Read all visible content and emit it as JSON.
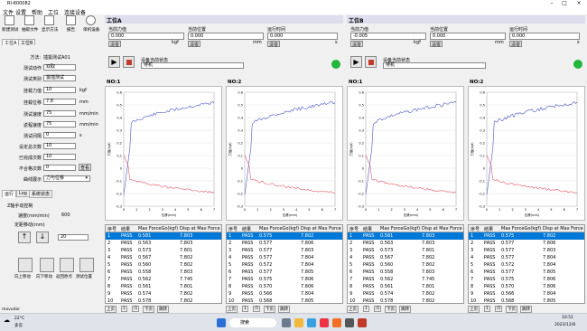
{
  "window": {
    "title": "RI-600082"
  },
  "menu": [
    "文件",
    "设置",
    "帮助",
    "工位",
    "连接设备"
  ],
  "toolbar": [
    {
      "label": "新建测试",
      "icon": "new-test-icon"
    },
    {
      "label": "抽取文件",
      "icon": "open-file-icon"
    },
    {
      "label": "显示方法",
      "icon": "method-icon"
    },
    {
      "label": "报告",
      "icon": "report-icon"
    },
    {
      "label": "单机设备",
      "icon": "gear-icon"
    }
  ],
  "left_tabs": [
    "工位A",
    "工位B"
  ],
  "method": {
    "label": "方法:",
    "value": "插拔测试A01"
  },
  "params": [
    {
      "label": "测试动作",
      "value": "双取",
      "unit": ""
    },
    {
      "label": "测试类别",
      "value": "拔插测试",
      "unit": ""
    },
    {
      "label": "挂载力值",
      "value": "10",
      "unit": "kgf"
    },
    {
      "label": "挂载位移",
      "value": "7.8",
      "unit": "mm"
    },
    {
      "label": "测试速度",
      "value": "75",
      "mm_unit": true,
      "unit": "mm/min"
    },
    {
      "label": "返程速度",
      "value": "75",
      "unit": "mm/min"
    },
    {
      "label": "测试间隔",
      "value": "0",
      "unit": "s"
    },
    {
      "label": "设定总次数",
      "value": "10",
      "unit": ""
    },
    {
      "label": "已完成次数",
      "value": "10",
      "unit": ""
    },
    {
      "label": "不合格次数",
      "value": "0",
      "unit": ""
    }
  ],
  "view_btn": "查看",
  "curve_label": "曲线展示",
  "curve_select": "力与位移",
  "bottom_tabs": [
    "运行",
    "Log",
    "系统状态"
  ],
  "jog": {
    "title": "Z轴手动控制",
    "speed_label": "速度(mm/min)",
    "speed": "600",
    "step_label": "定距移动(mm)",
    "step": "20"
  },
  "jog_buttons": [
    "向上移动",
    "向下移动",
    "返回原点",
    "测试位置"
  ],
  "status_user": "mavudar",
  "stations": [
    {
      "name": "工位A",
      "force_label": "当前力值",
      "force": "0.000",
      "force_unit": "kgf",
      "pos_label": "当前位置",
      "pos": "0.000",
      "pos_unit": "mm",
      "time_label": "运行时间",
      "time": "0.000",
      "time_unit": "s",
      "clear": "清零",
      "status_label": "设备当前状态",
      "status": "待机",
      "charts": [
        {
          "title": "NO:1"
        },
        {
          "title": "NO:2"
        }
      ],
      "tables": [
        {
          "rows": [
            [
              "1",
              "PASS",
              "0.581",
              "7.803"
            ],
            [
              "2",
              "PASS",
              "0.563",
              "7.803"
            ],
            [
              "3",
              "PASS",
              "0.573",
              "7.801"
            ],
            [
              "4",
              "PASS",
              "0.567",
              "7.802"
            ],
            [
              "5",
              "PASS",
              "0.560",
              "7.802"
            ],
            [
              "6",
              "PASS",
              "0.558",
              "7.803"
            ],
            [
              "7",
              "PASS",
              "0.562",
              "7.745"
            ],
            [
              "8",
              "PASS",
              "0.561",
              "7.801"
            ],
            [
              "9",
              "PASS",
              "0.574",
              "7.802"
            ],
            [
              "10",
              "PASS",
              "0.578",
              "7.802"
            ]
          ]
        },
        {
          "rows": [
            [
              "1",
              "PASS",
              "0.575",
              "7.802"
            ],
            [
              "2",
              "PASS",
              "0.577",
              "7.806"
            ],
            [
              "3",
              "PASS",
              "0.577",
              "7.803"
            ],
            [
              "4",
              "PASS",
              "0.577",
              "7.804"
            ],
            [
              "5",
              "PASS",
              "0.572",
              "7.804"
            ],
            [
              "6",
              "PASS",
              "0.577",
              "7.805"
            ],
            [
              "7",
              "PASS",
              "0.575",
              "7.806"
            ],
            [
              "8",
              "PASS",
              "0.570",
              "7.806"
            ],
            [
              "9",
              "PASS",
              "0.566",
              "7.804"
            ],
            [
              "10",
              "PASS",
              "0.568",
              "7.805"
            ]
          ]
        }
      ]
    },
    {
      "name": "工位B",
      "force_label": "当前力值",
      "force": "-0.005",
      "force_unit": "kgf",
      "pos_label": "当前位置",
      "pos": "0.000",
      "pos_unit": "mm",
      "time_label": "运行时间",
      "time": "0.000",
      "time_unit": "s",
      "clear": "清零",
      "status_label": "设备当前状态",
      "status": "待机",
      "charts": [
        {
          "title": "NO:1"
        },
        {
          "title": "NO:2"
        }
      ],
      "tables": [
        {
          "rows": [
            [
              "1",
              "PASS",
              "0.581",
              "7.803"
            ],
            [
              "2",
              "PASS",
              "0.563",
              "7.803"
            ],
            [
              "3",
              "PASS",
              "0.573",
              "7.801"
            ],
            [
              "4",
              "PASS",
              "0.567",
              "7.802"
            ],
            [
              "5",
              "PASS",
              "0.560",
              "7.802"
            ],
            [
              "6",
              "PASS",
              "0.558",
              "7.803"
            ],
            [
              "7",
              "PASS",
              "0.562",
              "7.745"
            ],
            [
              "8",
              "PASS",
              "0.561",
              "7.801"
            ],
            [
              "9",
              "PASS",
              "0.574",
              "7.802"
            ],
            [
              "10",
              "PASS",
              "0.578",
              "7.802"
            ]
          ]
        },
        {
          "rows": [
            [
              "1",
              "PASS",
              "0.575",
              "7.802"
            ],
            [
              "2",
              "PASS",
              "0.577",
              "7.806"
            ],
            [
              "3",
              "PASS",
              "0.577",
              "7.803"
            ],
            [
              "4",
              "PASS",
              "0.577",
              "7.804"
            ],
            [
              "5",
              "PASS",
              "0.572",
              "7.804"
            ],
            [
              "6",
              "PASS",
              "0.577",
              "7.805"
            ],
            [
              "7",
              "PASS",
              "0.575",
              "7.806"
            ],
            [
              "8",
              "PASS",
              "0.570",
              "7.806"
            ],
            [
              "9",
              "PASS",
              "0.566",
              "7.804"
            ],
            [
              "10",
              "PASS",
              "0.568",
              "7.805"
            ]
          ]
        }
      ]
    }
  ],
  "table_headers": [
    "序号",
    "结果",
    "Max ForceGo(kgf)",
    "Disp at Max Force"
  ],
  "chart_axes": {
    "ylabel": "力值(kgf)",
    "xlabel": "位移(mm)",
    "yticks": [
      "0.6",
      "0.5",
      "0.4",
      "0.3",
      "0.2",
      "0.1",
      "0",
      "-0.1",
      "-0.2",
      "-0.3"
    ],
    "xticks": [
      "0",
      "1",
      "2",
      "3",
      "4",
      "5",
      "6",
      "7"
    ]
  },
  "pager": [
    "上页",
    "1",
    "/1",
    "下页",
    "跳转"
  ],
  "taskbar": {
    "weather_temp": "22°C",
    "weather_text": "多云",
    "search": "搜索",
    "time": "10:51",
    "date": "2023/12/8"
  },
  "colors": {
    "accent": "#0078d7",
    "status_green": "#22b63c",
    "push_curve": "#4a55c8",
    "pull_curve": "#e05a6a"
  }
}
